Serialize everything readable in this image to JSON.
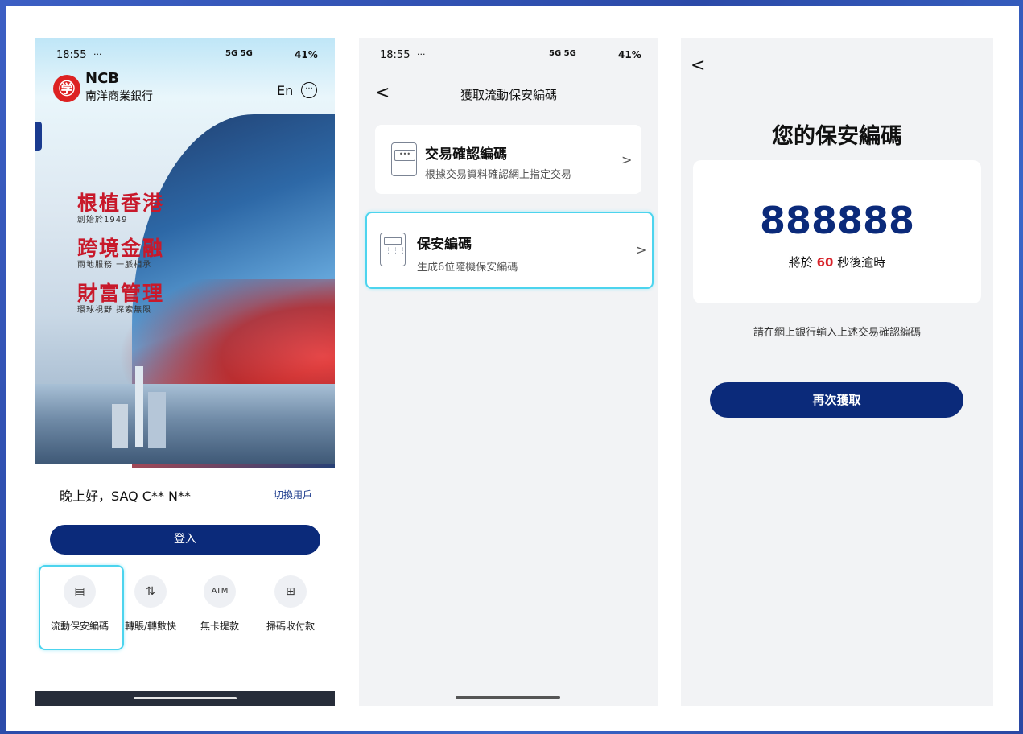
{
  "phone1": {
    "status_time": "18:55",
    "status_dots": "···",
    "status_battery": "41%",
    "status_network": "5G 5G",
    "logo_mark": "㊫",
    "logo_ncb": "NCB",
    "logo_cn": "南洋商業銀行",
    "lang_button": "En",
    "more_icon": "···",
    "slogans": [
      {
        "title": "根植香港",
        "sub": "創始於1949"
      },
      {
        "title": "跨境金融",
        "sub": "兩地服務 一脈相承"
      },
      {
        "title": "財富管理",
        "sub": "環球視野 探索無限"
      }
    ],
    "greeting": "晚上好，SAQ C** N**",
    "switch_user": "切換用戶",
    "login_label": "登入",
    "quick_actions": [
      {
        "label": "流動保安編碼",
        "icon": "▤"
      },
      {
        "label": "轉賬/轉數快",
        "icon": "⇅"
      },
      {
        "label": "無卡提款",
        "icon": "ATM"
      },
      {
        "label": "掃碼收付款",
        "icon": "⊞"
      }
    ]
  },
  "phone2": {
    "status_time": "18:55",
    "status_dots": "···",
    "status_battery": "41%",
    "status_network": "5G 5G",
    "back_icon": "<",
    "title": "獲取流動保安編碼",
    "cards": [
      {
        "title": "交易確認編碼",
        "subtitle": "根據交易資料確認網上指定交易",
        "chevron": ">"
      },
      {
        "title": "保安編碼",
        "subtitle": "生成6位隨機保安編碼",
        "chevron": ">"
      }
    ]
  },
  "phone3": {
    "back_icon": "<",
    "title": "您的保安編碼",
    "code": "888888",
    "timer_prefix": "將於",
    "timer_seconds": "60",
    "timer_suffix": "秒後逾時",
    "note": "請在網上銀行輸入上述交易確認編碼",
    "retry_label": "再次獲取"
  },
  "colors": {
    "brand_navy": "#0b2a7a",
    "brand_red": "#c8192b",
    "highlight_cyan": "#4cd4ee",
    "timer_red": "#d8232a"
  }
}
